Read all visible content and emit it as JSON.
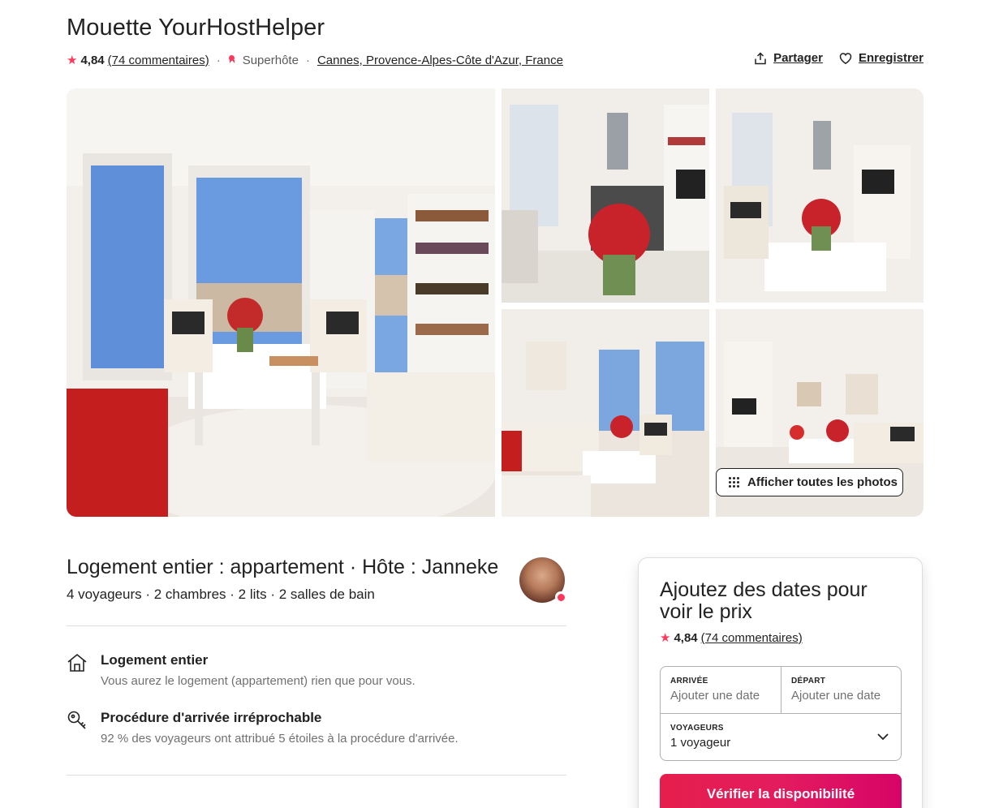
{
  "listing": {
    "title": "Mouette YourHostHelper",
    "rating": "4,84",
    "reviews": "(74 commentaires)",
    "sep": "·",
    "superhost": "Superhôte",
    "location": "Cannes, Provence-Alpes-Côte d'Azur, France"
  },
  "actions": {
    "share": "Partager",
    "save": "Enregistrer"
  },
  "gallery": {
    "show_all": "Afficher toutes les photos"
  },
  "summary": {
    "title": "Logement entier : appartement · Hôte : Janneke",
    "details": "4 voyageurs · 2 chambres · 2 lits · 2 salles de bain"
  },
  "features": [
    {
      "title": "Logement entier",
      "desc": "Vous aurez le logement (appartement) rien que pour vous.",
      "icon": "home-icon"
    },
    {
      "title": "Procédure d'arrivée irréprochable",
      "desc": "92 % des voyageurs ont attribué 5 étoiles à la procédure d'arrivée.",
      "icon": "key-icon"
    }
  ],
  "booking": {
    "title": "Ajoutez des dates pour voir le prix",
    "rating": "4,84",
    "reviews": "(74 commentaires)",
    "checkin_label": "ARRIVÉE",
    "checkin_value": "Ajouter une date",
    "checkout_label": "DÉPART",
    "checkout_value": "Ajouter une date",
    "guests_label": "VOYAGEURS",
    "guests_value": "1 voyageur",
    "cta": "Vérifier la disponibilité"
  },
  "colors": {
    "brand": "#FF385C",
    "text": "#222222",
    "muted": "#717171"
  }
}
